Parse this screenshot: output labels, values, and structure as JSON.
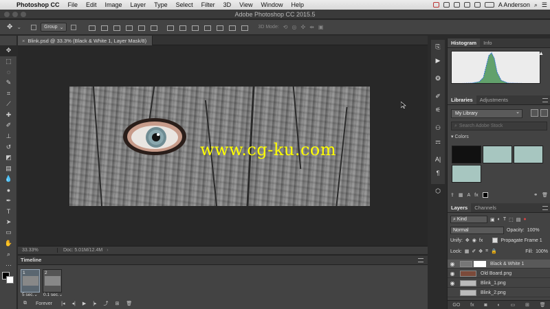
{
  "menubar": {
    "app_name": "Photoshop CC",
    "items": [
      "File",
      "Edit",
      "Image",
      "Layer",
      "Type",
      "Select",
      "Filter",
      "3D",
      "View",
      "Window",
      "Help"
    ],
    "user": "A Anderson"
  },
  "window": {
    "title": "Adobe Photoshop CC 2015.5"
  },
  "options_bar": {
    "auto_select_value": "Group",
    "mode_3d_label": "3D Mode:"
  },
  "document": {
    "tab_title": "Blink.psd @ 33.3% (Black & White 1, Layer Mask/8)",
    "watermark": "www.cg-ku.com"
  },
  "status": {
    "zoom": "33.33%",
    "doc_size": "Doc: 5.01M/12.4M"
  },
  "timeline": {
    "title": "Timeline",
    "frames": [
      {
        "num": "1",
        "duration": "5 sec.⌄"
      },
      {
        "num": "2",
        "duration": "0.1 sec.⌄"
      }
    ],
    "loop": "Forever"
  },
  "histogram_panel": {
    "tabs": [
      "Histogram",
      "Info"
    ],
    "warning": "▲"
  },
  "libraries_panel": {
    "tabs": [
      "Libraries",
      "Adjustments"
    ],
    "library": "My Library",
    "search_placeholder": "Search Adobe Stock",
    "colors_header": "Colors",
    "swatches": [
      "#111111",
      "#a7c6c0",
      "#a7c6c0",
      "#a7c6c0"
    ]
  },
  "layers_panel": {
    "tabs": [
      "Layers",
      "Channels"
    ],
    "filter_kind": "Kind",
    "blend_mode": "Normal",
    "opacity_label": "Opacity:",
    "opacity_value": "100%",
    "unify_label": "Unify:",
    "propagate_label": "Propagate Frame 1",
    "lock_label": "Lock:",
    "fill_label": "Fill:",
    "fill_value": "100%",
    "layers": [
      {
        "name": "Black & White 1",
        "selected": true
      },
      {
        "name": "Old Board.png",
        "selected": false
      },
      {
        "name": "Blink_1.png",
        "selected": false
      },
      {
        "name": "Blink_2.png",
        "selected": false
      }
    ],
    "footer": [
      "GO",
      "fx"
    ]
  }
}
